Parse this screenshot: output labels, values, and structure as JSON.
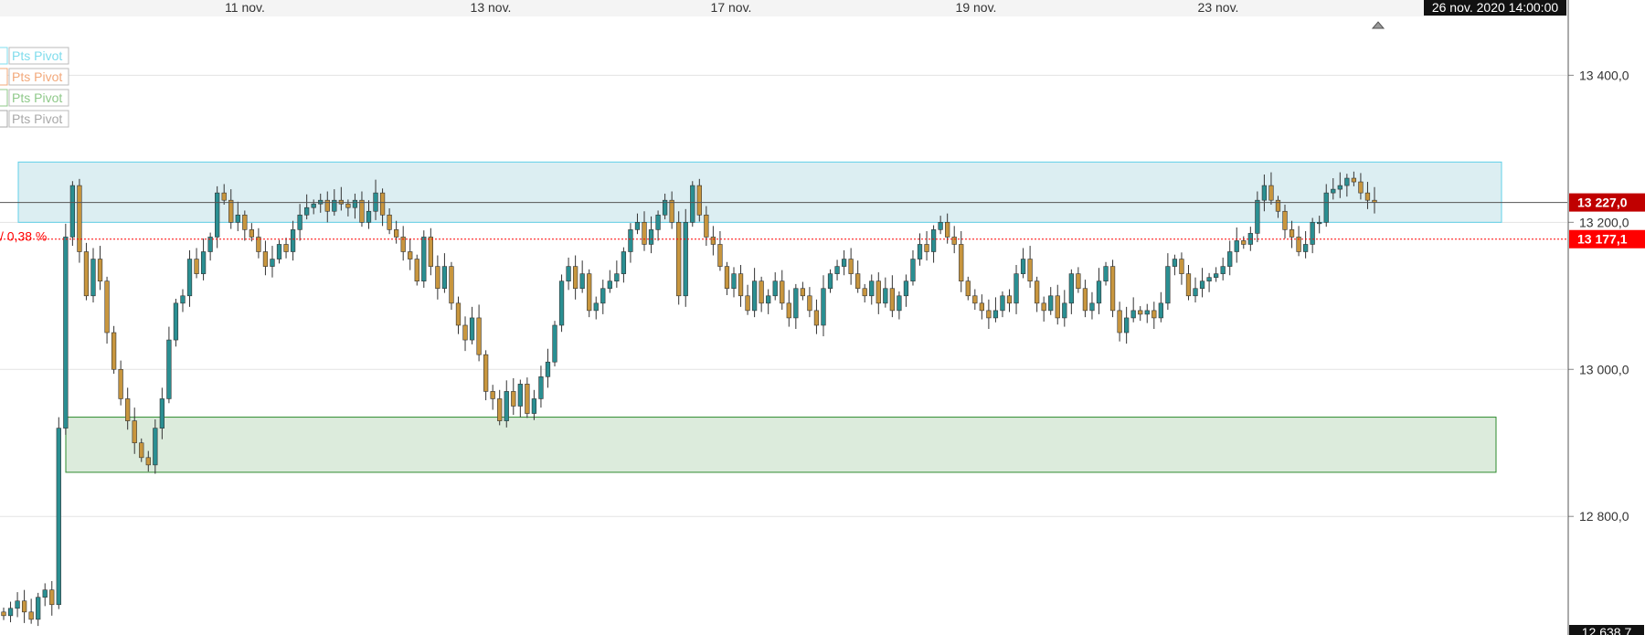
{
  "chart_data": {
    "type": "candlestick",
    "title": "",
    "xlabel": "",
    "ylabel": "",
    "x_ticks": [
      "11 nov.",
      "13 nov.",
      "17 nov.",
      "19 nov.",
      "23 nov."
    ],
    "y_ticks": [
      "13 400,0",
      "13 200,0",
      "13 000,0",
      "12 800,0"
    ],
    "y_tick_values": [
      13400,
      13200,
      13000,
      12800
    ],
    "ylim": [
      12638.7,
      13480
    ],
    "cursor_date": "26 nov. 2020 14:00:00",
    "bottom_price": "12 638,7",
    "grid": true,
    "colors": {
      "up": "#2a8f92",
      "down": "#c8963e",
      "wick": "#333333"
    },
    "last_price": {
      "label": "13 227,0",
      "value": 13227,
      "color": "#c00000"
    },
    "reference_price": {
      "label": "13 177,1",
      "value": 13177.1,
      "color": "#ff0000"
    },
    "variation_label": "/ 0,38 %",
    "legend": [
      {
        "label": "Pts Pivot",
        "color": "#7fdcec"
      },
      {
        "label": "Pts Pivot",
        "color": "#f2a87a"
      },
      {
        "label": "Pts Pivot",
        "color": "#8fc98a"
      },
      {
        "label": "Pts Pivot",
        "color": "#a8a8a8"
      }
    ],
    "zones": [
      {
        "kind": "resistance",
        "low": 13200,
        "high": 13282,
        "fill": "#dceef2",
        "stroke": "#5fd0e8"
      },
      {
        "kind": "support",
        "low": 12860,
        "high": 12935,
        "fill": "#dcebdc",
        "stroke": "#2e8b2e"
      }
    ],
    "closes": [
      12665,
      12675,
      12685,
      12670,
      12660,
      12690,
      12700,
      12680,
      12920,
      13180,
      13250,
      13160,
      13100,
      13150,
      13120,
      13050,
      13000,
      12960,
      12930,
      12900,
      12880,
      12870,
      12920,
      12960,
      13040,
      13090,
      13100,
      13150,
      13130,
      13160,
      13180,
      13240,
      13230,
      13200,
      13210,
      13190,
      13180,
      13160,
      13140,
      13150,
      13170,
      13160,
      13190,
      13210,
      13220,
      13225,
      13230,
      13215,
      13230,
      13225,
      13220,
      13230,
      13200,
      13215,
      13240,
      13210,
      13190,
      13180,
      13160,
      13150,
      13120,
      13180,
      13140,
      13110,
      13140,
      13090,
      13060,
      13040,
      13070,
      13020,
      12970,
      12960,
      12930,
      12970,
      12950,
      12980,
      12940,
      12960,
      12990,
      13010,
      13060,
      13120,
      13140,
      13110,
      13130,
      13080,
      13090,
      13110,
      13120,
      13130,
      13160,
      13190,
      13200,
      13170,
      13190,
      13210,
      13230,
      13200,
      13100,
      13200,
      13250,
      13210,
      13180,
      13170,
      13140,
      13110,
      13130,
      13100,
      13080,
      13120,
      13090,
      13100,
      13120,
      13090,
      13070,
      13110,
      13100,
      13080,
      13060,
      13110,
      13130,
      13140,
      13150,
      13130,
      13110,
      13100,
      13120,
      13090,
      13110,
      13080,
      13100,
      13120,
      13150,
      13170,
      13160,
      13190,
      13200,
      13180,
      13170,
      13120,
      13100,
      13090,
      13080,
      13070,
      13080,
      13100,
      13090,
      13130,
      13150,
      13120,
      13090,
      13080,
      13100,
      13070,
      13090,
      13130,
      13110,
      13080,
      13090,
      13120,
      13140,
      13080,
      13050,
      13070,
      13080,
      13075,
      13080,
      13070,
      13090,
      13140,
      13150,
      13130,
      13100,
      13110,
      13120,
      13125,
      13130,
      13140,
      13160,
      13175,
      13170,
      13185,
      13230,
      13250,
      13230,
      13215,
      13190,
      13180,
      13160,
      13170,
      13200,
      13200,
      13240,
      13245,
      13250,
      13260,
      13255,
      13240,
      13230,
      13227
    ],
    "opens": [
      12670,
      12665,
      12675,
      12685,
      12670,
      12660,
      12690,
      12700,
      12680,
      12920,
      13180,
      13250,
      13160,
      13100,
      13150,
      13120,
      13050,
      13000,
      12960,
      12930,
      12900,
      12880,
      12870,
      12920,
      12960,
      13040,
      13090,
      13100,
      13150,
      13130,
      13160,
      13180,
      13240,
      13230,
      13200,
      13210,
      13190,
      13180,
      13160,
      13140,
      13150,
      13170,
      13160,
      13190,
      13210,
      13220,
      13225,
      13230,
      13215,
      13230,
      13225,
      13220,
      13230,
      13200,
      13215,
      13240,
      13210,
      13190,
      13180,
      13160,
      13150,
      13120,
      13180,
      13140,
      13110,
      13140,
      13090,
      13060,
      13040,
      13070,
      13020,
      12970,
      12960,
      12930,
      12970,
      12950,
      12980,
      12940,
      12960,
      12990,
      13010,
      13060,
      13120,
      13140,
      13110,
      13130,
      13080,
      13090,
      13110,
      13120,
      13130,
      13160,
      13190,
      13200,
      13170,
      13190,
      13210,
      13230,
      13200,
      13100,
      13200,
      13250,
      13210,
      13180,
      13170,
      13140,
      13110,
      13130,
      13100,
      13080,
      13120,
      13090,
      13100,
      13120,
      13090,
      13070,
      13110,
      13100,
      13080,
      13060,
      13110,
      13130,
      13140,
      13150,
      13130,
      13110,
      13100,
      13120,
      13090,
      13110,
      13080,
      13100,
      13120,
      13150,
      13170,
      13160,
      13190,
      13200,
      13180,
      13170,
      13120,
      13100,
      13090,
      13080,
      13070,
      13080,
      13100,
      13090,
      13130,
      13150,
      13120,
      13090,
      13080,
      13100,
      13070,
      13090,
      13130,
      13110,
      13080,
      13090,
      13120,
      13140,
      13080,
      13050,
      13070,
      13080,
      13075,
      13080,
      13070,
      13090,
      13140,
      13150,
      13130,
      13100,
      13110,
      13120,
      13125,
      13130,
      13140,
      13160,
      13175,
      13170,
      13185,
      13230,
      13250,
      13230,
      13215,
      13190,
      13180,
      13160,
      13170,
      13200,
      13200,
      13240,
      13245,
      13250,
      13260,
      13255,
      13240,
      13230
    ]
  }
}
